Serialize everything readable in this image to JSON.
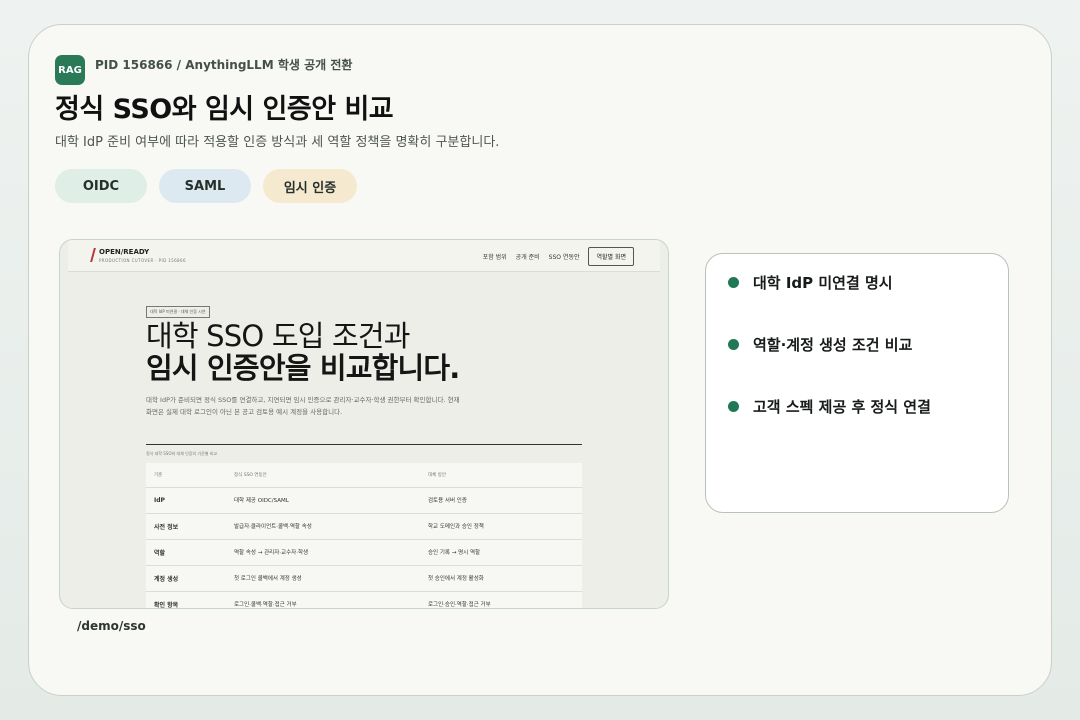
{
  "header": {
    "logo_text": "RAG",
    "eyebrow": "PID 156866 / AnythingLLM 학생 공개 전환",
    "title": "정식 SSO와 임시 인증안 비교",
    "subtitle": "대학 IdP 준비 여부에 따라 적용할 인증 방식과 세 역할 정책을 명확히 구분합니다.",
    "chips": [
      "OIDC",
      "SAML",
      "임시 인증"
    ]
  },
  "screenshot": {
    "brand": "OPEN/READY",
    "brand_sub": "PRODUCTION CUTOVER · PID 156866",
    "nav": [
      "포함 범위",
      "공개 준비",
      "SSO 연동안"
    ],
    "nav_button": "역할별 화면",
    "hero_tag": "대학 IdP 미연결 · 대체 인증 시연",
    "hero_line1": "대학 SSO 도입 조건과",
    "hero_line2": "임시 인증안을 비교합니다.",
    "hero_desc": "대학 IdP가 준비되면 정식 SSO를 연결하고, 지연되면 임시 인증으로 관리자·교수자·학생 권한부터 확인합니다. 현재 화면은 실제 대학 로그인이 아닌 본 공고 검토용 예시 계정을 사용합니다.",
    "table_note": "정식 대학 SSO와 대체 인증의 기준별 비교",
    "columns": [
      "기준",
      "정식 SSO 연동안",
      "대체 방안"
    ],
    "rows": [
      [
        "IdP",
        "대학 제공 OIDC/SAML",
        "검토용 서버 인증"
      ],
      [
        "사전 정보",
        "발급자·클라이언트·콜백·역할 속성",
        "학교 도메인과 승인 정책"
      ],
      [
        "역할",
        "역할 속성 → 관리자·교수자·학생",
        "승인 기록 → 명시 역할"
      ],
      [
        "계정 생성",
        "첫 로그인 콜백에서 계정 생성",
        "첫 승인에서 계정 활성화"
      ],
      [
        "확인 항목",
        "로그인·콜백·역할·접근 거부",
        "로그인·승인·역할·접근 거부"
      ]
    ]
  },
  "caption": "/demo/sso",
  "highlights": [
    "대학 IdP 미연결 명시",
    "역할·계정 생성 조건 비교",
    "고객 스펙 제공 후 정식 연결"
  ],
  "colors": {
    "accent": "#207854",
    "logo": "#2a7a58",
    "brand_mark": "#b9343c"
  }
}
